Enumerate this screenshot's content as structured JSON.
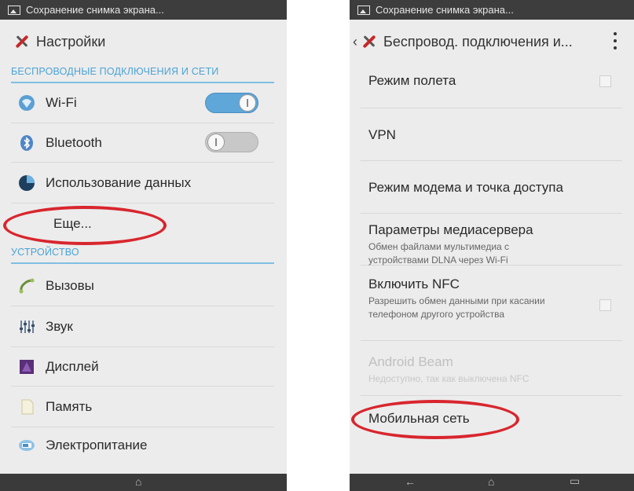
{
  "left": {
    "status_text": "Сохранение снимка экрана...",
    "title": "Настройки",
    "section_wireless": "БЕСПРОВОДНЫЕ ПОДКЛЮЧЕНИЯ И СЕТИ",
    "wifi": {
      "label": "Wi-Fi",
      "enabled": true
    },
    "bluetooth": {
      "label": "Bluetooth",
      "enabled": false
    },
    "data_usage": "Использование данных",
    "more": "Еще...",
    "section_device": "УСТРОЙСТВО",
    "calls": "Вызовы",
    "sound": "Звук",
    "display": "Дисплей",
    "memory": "Память",
    "power": "Электропитание"
  },
  "right": {
    "status_text": "Сохранение снимка экрана...",
    "title": "Беспровод. подключения и...",
    "airplane": "Режим полета",
    "vpn": "VPN",
    "tethering": "Режим модема и точка доступа",
    "media_server": {
      "title": "Параметры медиасервера",
      "subtitle": "Обмен файлами мультимедиа с устройствами DLNA через Wi-Fi"
    },
    "nfc": {
      "title": "Включить NFC",
      "subtitle": "Разрешить обмен данными при касании телефоном другого устройства"
    },
    "android_beam": {
      "title": "Android Beam",
      "subtitle": "Недоступно, так как выключена NFC"
    },
    "mobile_network": "Мобильная сеть"
  },
  "colors": {
    "accent": "#4aa3d6",
    "highlight": "#d8262e",
    "statusbar": "#3d3d3d"
  }
}
